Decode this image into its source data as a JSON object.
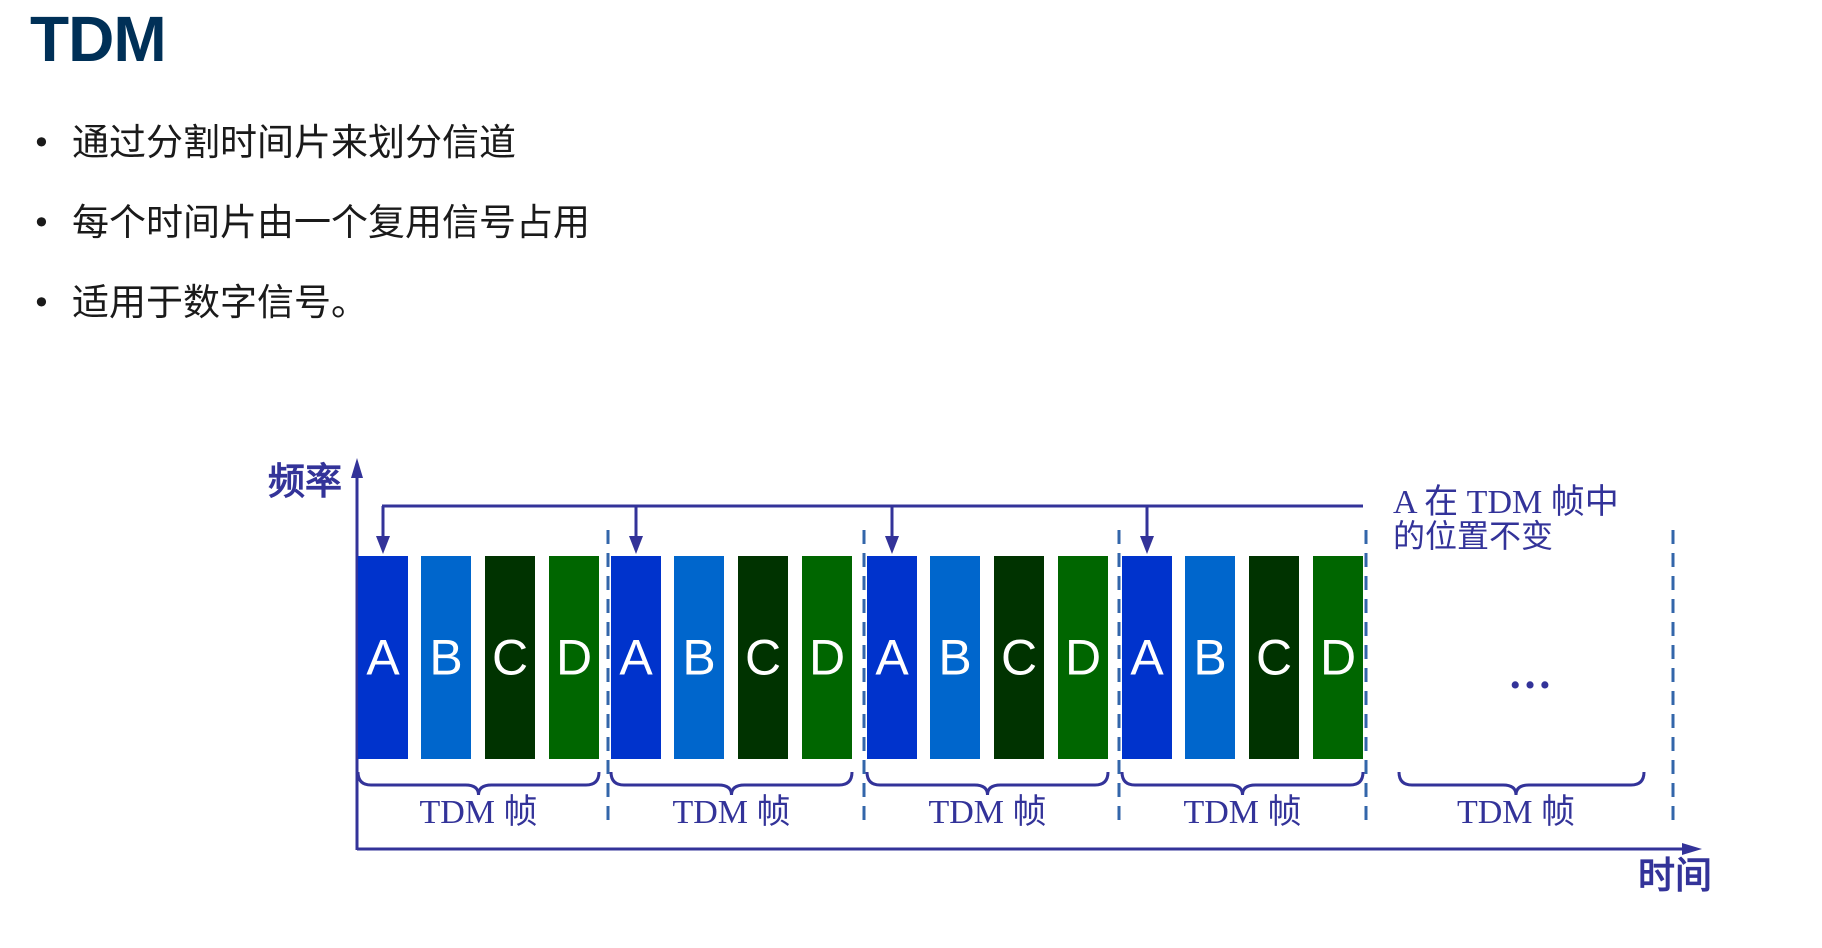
{
  "title": "TDM",
  "bullets": [
    "通过分割时间片来划分信道",
    "每个时间片由一个复用信号占用",
    "适用于数字信号。"
  ],
  "diagram": {
    "y_axis_label": "频率",
    "x_axis_label": "时间",
    "annotation_line1": "A 在 TDM 帧中",
    "annotation_line2": "的位置不变",
    "slot_labels": [
      "A",
      "B",
      "C",
      "D"
    ],
    "frame_label": "TDM 帧",
    "frame_count": 4,
    "ellipsis": "…",
    "colors": {
      "A": "#0033cc",
      "B": "#0066cc",
      "C": "#003300",
      "D": "#006600",
      "diagram": "#333399",
      "title": "#003057"
    }
  }
}
